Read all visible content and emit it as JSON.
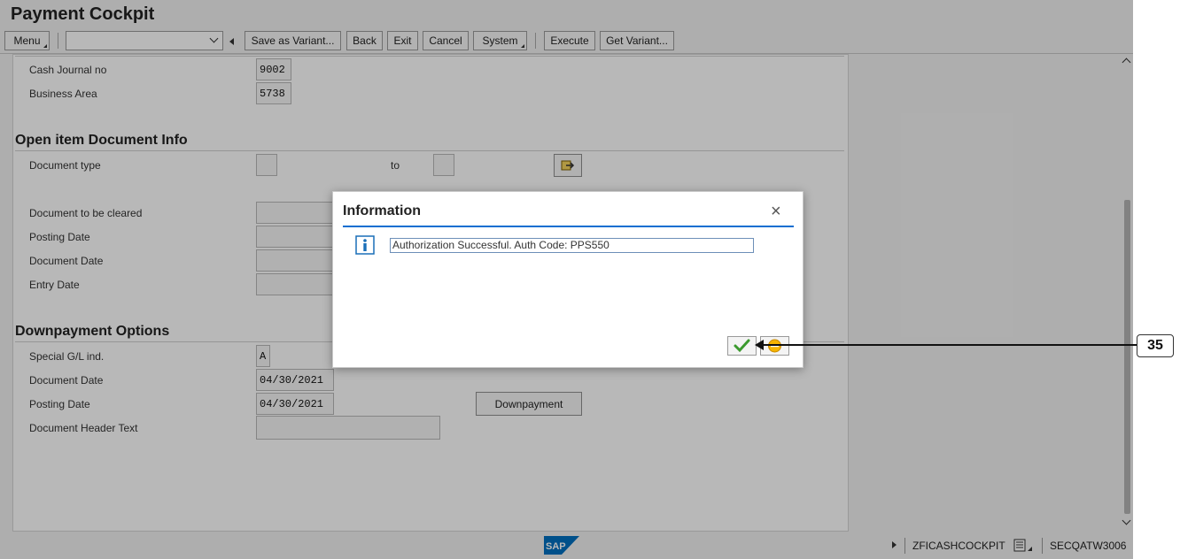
{
  "app": {
    "title": "Payment Cockpit"
  },
  "toolbar": {
    "menu_label": "Menu",
    "combo_value": "",
    "save_variant_label": "Save as Variant...",
    "back_label": "Back",
    "exit_label": "Exit",
    "cancel_label": "Cancel",
    "system_label": "System",
    "execute_label": "Execute",
    "get_variant_label": "Get Variant..."
  },
  "form": {
    "cash_journal_label": "Cash Journal  no",
    "cash_journal_value": "9002",
    "business_area_label": "Business Area",
    "business_area_value": "5738",
    "open_item_section": "Open item Document Info",
    "document_type_label": "Document type",
    "document_type_from": "",
    "to_label": "to",
    "document_type_to": "",
    "document_to_clear_label": "Document to be cleared",
    "posting_date_label": "Posting Date",
    "document_date_label": "Document Date",
    "entry_date_label": "Entry Date",
    "downpayment_section": "Downpayment Options",
    "special_gl_label": "Special G/L ind.",
    "special_gl_value": "A",
    "dp_document_date_label": "Document Date",
    "dp_document_date_value": "04/30/2021",
    "dp_posting_date_label": "Posting Date",
    "dp_posting_date_value": "04/30/2021",
    "downpayment_button": "Downpayment",
    "doc_header_text_label": "Document Header Text",
    "doc_header_text_value": ""
  },
  "dialog": {
    "title": "Information",
    "close_glyph": "×",
    "message": "Authorization Successful. Auth Code: PPS550"
  },
  "status_bar": {
    "transaction": "ZFICASHCOCKPIT",
    "system": "SECQATW3006"
  },
  "callout": {
    "number": "35"
  },
  "colors": {
    "accent": "#0a6ed1",
    "sap_blue": "#0070c0",
    "ok_green": "#3b9a2e",
    "cancel_orange": "#f0a000"
  }
}
